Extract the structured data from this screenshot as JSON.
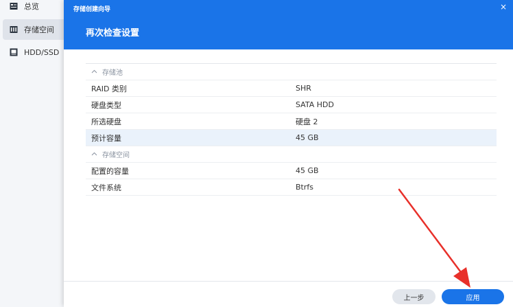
{
  "sidebar": {
    "items": [
      {
        "label": "总览",
        "icon": "overview-icon"
      },
      {
        "label": "存储空间",
        "icon": "storage-icon",
        "active": true
      },
      {
        "label": "HDD/SSD",
        "icon": "disk-icon"
      }
    ]
  },
  "dialog": {
    "title": "存储创建向导",
    "close_label": "×",
    "heading": "再次检查设置",
    "sections": [
      {
        "label": "存储池",
        "rows": [
          {
            "key": "RAID 类别",
            "value": "SHR"
          },
          {
            "key": "硬盘类型",
            "value": "SATA HDD"
          },
          {
            "key": "所选硬盘",
            "value": "硬盘 2"
          },
          {
            "key": "预计容量",
            "value": "45 GB"
          }
        ]
      },
      {
        "label": "存储空间",
        "rows": [
          {
            "key": "配置的容量",
            "value": "45 GB"
          },
          {
            "key": "文件系统",
            "value": "Btrfs"
          }
        ]
      }
    ],
    "buttons": {
      "back": "上一步",
      "apply": "应用"
    }
  },
  "colors": {
    "accent": "#1a74e8",
    "annotation": "#e8302a",
    "highlight_row": "#eaf2fb"
  }
}
